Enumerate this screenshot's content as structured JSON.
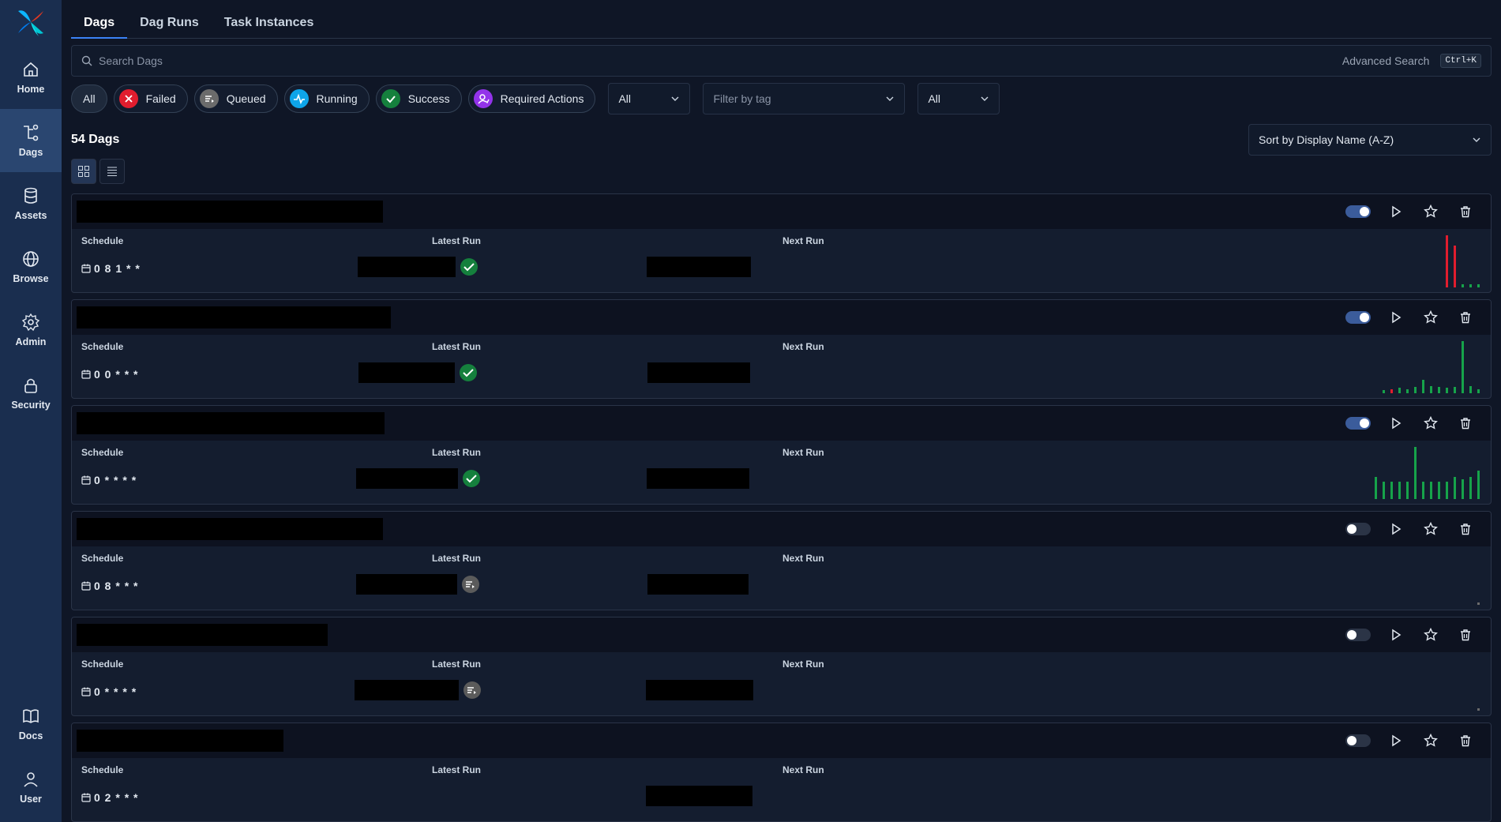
{
  "sidebar": {
    "items": [
      {
        "label": "Home",
        "icon": "home-icon"
      },
      {
        "label": "Dags",
        "icon": "dags-icon",
        "active": true
      },
      {
        "label": "Assets",
        "icon": "database-icon"
      },
      {
        "label": "Browse",
        "icon": "globe-icon"
      },
      {
        "label": "Admin",
        "icon": "gear-icon"
      },
      {
        "label": "Security",
        "icon": "lock-icon"
      }
    ],
    "bottom": [
      {
        "label": "Docs",
        "icon": "book-icon"
      },
      {
        "label": "User",
        "icon": "user-icon"
      }
    ]
  },
  "tabs": [
    "Dags",
    "Dag Runs",
    "Task Instances"
  ],
  "search": {
    "placeholder": "Search Dags",
    "advanced": "Advanced Search",
    "shortcut": "Ctrl+K"
  },
  "filters": {
    "all": "All",
    "states": [
      {
        "label": "Failed",
        "color": "#e11d2e"
      },
      {
        "label": "Queued",
        "color": "#6b6b6b"
      },
      {
        "label": "Running",
        "color": "#0ea5e9"
      },
      {
        "label": "Success",
        "color": "#15803d"
      },
      {
        "label": "Required Actions",
        "color": "#9333ea"
      }
    ],
    "select1": "All",
    "tag_placeholder": "Filter by tag",
    "select2": "All"
  },
  "count_label": "54 Dags",
  "sort_label": "Sort by Display Name (A-Z)",
  "columns": {
    "schedule": "Schedule",
    "latest": "Latest Run",
    "next": "Next Run"
  },
  "dags": [
    {
      "schedule": "0 8 1 * *",
      "enabled": true,
      "latest_state": "success",
      "has_latest": true,
      "history": [
        {
          "v": 1.0,
          "c": "#e11d2e"
        },
        {
          "v": 0.8,
          "c": "#e11d2e"
        },
        {
          "v": 0.06,
          "c": "#16a34a"
        },
        {
          "v": 0.06,
          "c": "#16a34a"
        },
        {
          "v": 0.06,
          "c": "#16a34a"
        }
      ]
    },
    {
      "schedule": "0 0 * * *",
      "enabled": true,
      "latest_state": "success",
      "has_latest": true,
      "history": [
        {
          "v": 0.06,
          "c": "#16a34a"
        },
        {
          "v": 0.08,
          "c": "#e11d2e"
        },
        {
          "v": 0.1,
          "c": "#16a34a"
        },
        {
          "v": 0.08,
          "c": "#16a34a"
        },
        {
          "v": 0.12,
          "c": "#16a34a"
        },
        {
          "v": 0.26,
          "c": "#16a34a"
        },
        {
          "v": 0.14,
          "c": "#16a34a"
        },
        {
          "v": 0.12,
          "c": "#16a34a"
        },
        {
          "v": 0.1,
          "c": "#16a34a"
        },
        {
          "v": 0.12,
          "c": "#16a34a"
        },
        {
          "v": 1.0,
          "c": "#16a34a"
        },
        {
          "v": 0.14,
          "c": "#16a34a"
        },
        {
          "v": 0.08,
          "c": "#16a34a"
        }
      ]
    },
    {
      "schedule": "0 * * * *",
      "enabled": true,
      "latest_state": "success",
      "has_latest": true,
      "history": [
        {
          "v": 0.42,
          "c": "#16a34a"
        },
        {
          "v": 0.34,
          "c": "#16a34a"
        },
        {
          "v": 0.34,
          "c": "#16a34a"
        },
        {
          "v": 0.34,
          "c": "#16a34a"
        },
        {
          "v": 0.34,
          "c": "#16a34a"
        },
        {
          "v": 1.0,
          "c": "#16a34a"
        },
        {
          "v": 0.34,
          "c": "#16a34a"
        },
        {
          "v": 0.34,
          "c": "#16a34a"
        },
        {
          "v": 0.34,
          "c": "#16a34a"
        },
        {
          "v": 0.34,
          "c": "#16a34a"
        },
        {
          "v": 0.42,
          "c": "#16a34a"
        },
        {
          "v": 0.38,
          "c": "#16a34a"
        },
        {
          "v": 0.42,
          "c": "#16a34a"
        },
        {
          "v": 0.55,
          "c": "#16a34a"
        }
      ]
    },
    {
      "schedule": "0 8 * * *",
      "enabled": false,
      "latest_state": "queued",
      "has_latest": true,
      "history": [
        {
          "v": 0.04,
          "c": "#6b6b6b"
        }
      ]
    },
    {
      "schedule": "0 * * * *",
      "enabled": false,
      "latest_state": "queued",
      "has_latest": true,
      "history": [
        {
          "v": 0.04,
          "c": "#6b6b6b"
        }
      ]
    },
    {
      "schedule": "0 2 * * *",
      "enabled": false,
      "latest_state": "",
      "has_latest": false,
      "history": []
    }
  ]
}
